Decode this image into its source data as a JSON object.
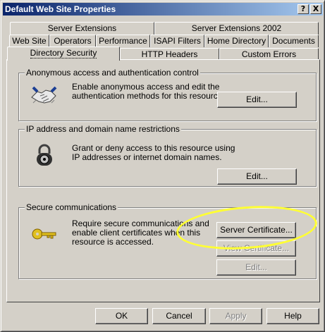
{
  "window": {
    "title": "Default Web Site Properties"
  },
  "titlebar_buttons": {
    "help": "?",
    "close": "X"
  },
  "tabs": [
    {
      "id": "server-extensions",
      "label": "Server Extensions"
    },
    {
      "id": "server-extensions-2002",
      "label": "Server Extensions 2002"
    },
    {
      "id": "web-site",
      "label": "Web Site"
    },
    {
      "id": "operators",
      "label": "Operators"
    },
    {
      "id": "performance",
      "label": "Performance"
    },
    {
      "id": "isapi-filters",
      "label": "ISAPI Filters"
    },
    {
      "id": "home-directory",
      "label": "Home Directory"
    },
    {
      "id": "documents",
      "label": "Documents"
    },
    {
      "id": "directory-security",
      "label": "Directory Security",
      "active": true
    },
    {
      "id": "http-headers",
      "label": "HTTP Headers"
    },
    {
      "id": "custom-errors",
      "label": "Custom Errors"
    }
  ],
  "groups": {
    "anonymous": {
      "label": "Anonymous access and authentication control",
      "description": "Enable anonymous access and edit the\nauthentication methods for this resource.",
      "edit_label": "Edit...",
      "icon": "handshake-icon"
    },
    "ip": {
      "label": "IP address and domain name restrictions",
      "description": "Grant or deny access to this resource using\nIP addresses or internet domain names.",
      "edit_label": "Edit...",
      "icon": "padlock-icon"
    },
    "secure": {
      "label": "Secure communications",
      "description": "Require secure communications and\nenable client certificates when this\nresource is accessed.",
      "server_certificate_label": "Server Certificate...",
      "view_certificate_label": "View Certificate...",
      "edit_label": "Edit...",
      "icon": "key-icon"
    }
  },
  "footer": {
    "ok": "OK",
    "cancel": "Cancel",
    "apply": "Apply",
    "help": "Help"
  },
  "colors": {
    "face": "#d4d0c8",
    "title_start": "#0a246a",
    "title_end": "#a6caf0",
    "highlight": "#ffff33"
  }
}
